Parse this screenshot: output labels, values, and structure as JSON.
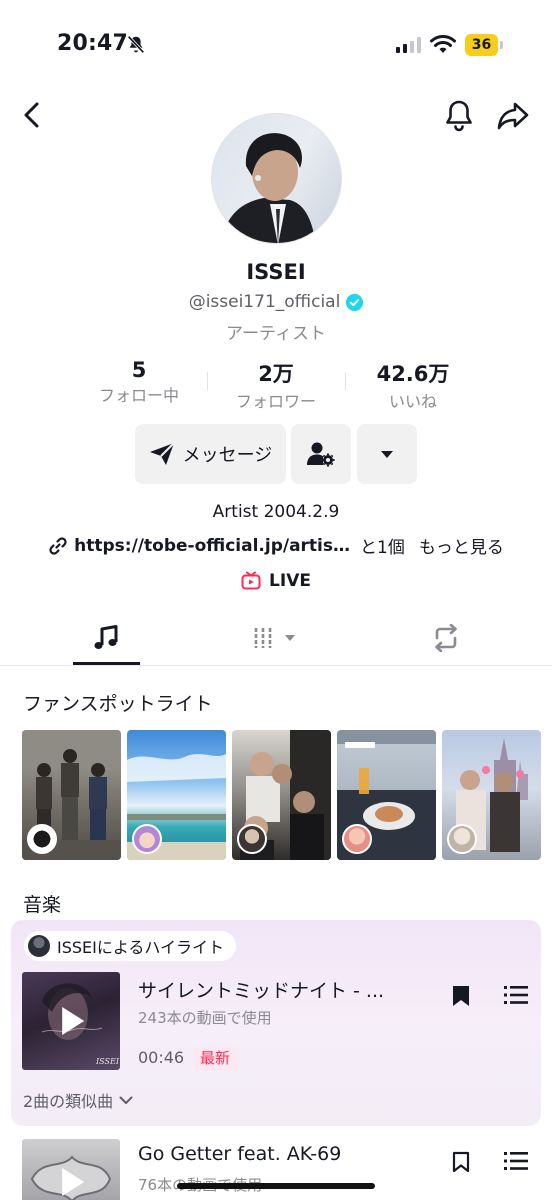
{
  "status_bar": {
    "time": "20:47",
    "battery": "36"
  },
  "profile": {
    "name": "ISSEI",
    "handle": "@issei171_official",
    "category": "アーティスト",
    "stats": [
      {
        "value": "5",
        "label": "フォロー中"
      },
      {
        "value": "2万",
        "label": "フォロワー"
      },
      {
        "value": "42.6万",
        "label": "いいね"
      }
    ],
    "message_button": "メッセージ",
    "bio": "Artist 2004.2.9",
    "link_url": "https://tobe-official.jp/artis…",
    "link_count": "と1個",
    "link_more": "もっと見る",
    "live_label": "LIVE"
  },
  "sections": {
    "fan_spotlight": "ファンスポットライト",
    "music": "音楽"
  },
  "highlight": {
    "pill": "ISSEIによるハイライト",
    "song_title": "サイレントミッドナイト - ...",
    "usage": "243本の動画で使用",
    "duration": "00:46",
    "badge": "最新",
    "similar": "2曲の類似曲"
  },
  "song2": {
    "title": "Go Getter feat. AK-69",
    "usage": "76本の動画で使用"
  },
  "colors": {
    "accent": "#fe2c55",
    "verified": "#20d5ec",
    "battery": "#f7cd1b"
  }
}
